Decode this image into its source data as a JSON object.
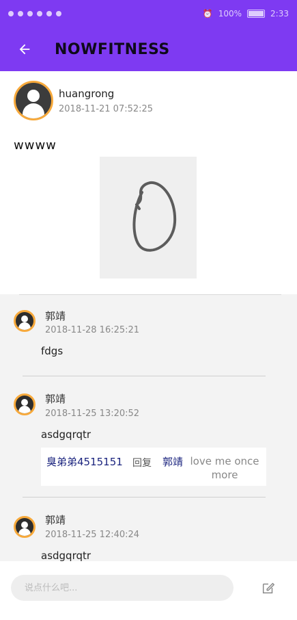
{
  "status_bar": {
    "battery": "100%",
    "time": "2:33"
  },
  "toolbar": {
    "back_icon": "arrow-left-icon",
    "title": "NOWFITNESS"
  },
  "post": {
    "user": "huangrong",
    "time": "2018-11-21 07:52:25",
    "text": "wwww"
  },
  "comments": [
    {
      "name": "郭靖",
      "time": "2018-11-28 16:25:21",
      "text": "fdgs"
    },
    {
      "name": "郭靖",
      "time": "2018-11-25 13:20:52",
      "text": "asdgqrqtr",
      "reply": {
        "from": "臭弟弟4515151",
        "word": "回复",
        "to": "郭靖",
        "message": "love me once more"
      }
    },
    {
      "name": "郭靖",
      "time": "2018-11-25 12:40:24",
      "text": "asdgqrqtr"
    }
  ],
  "bottom": {
    "placeholder": "说点什么吧...",
    "compose_icon": "compose-icon"
  },
  "colors": {
    "primary": "#7e3af2",
    "avatar_ring": "#f7a93b",
    "reply_name": "#1a237e"
  }
}
